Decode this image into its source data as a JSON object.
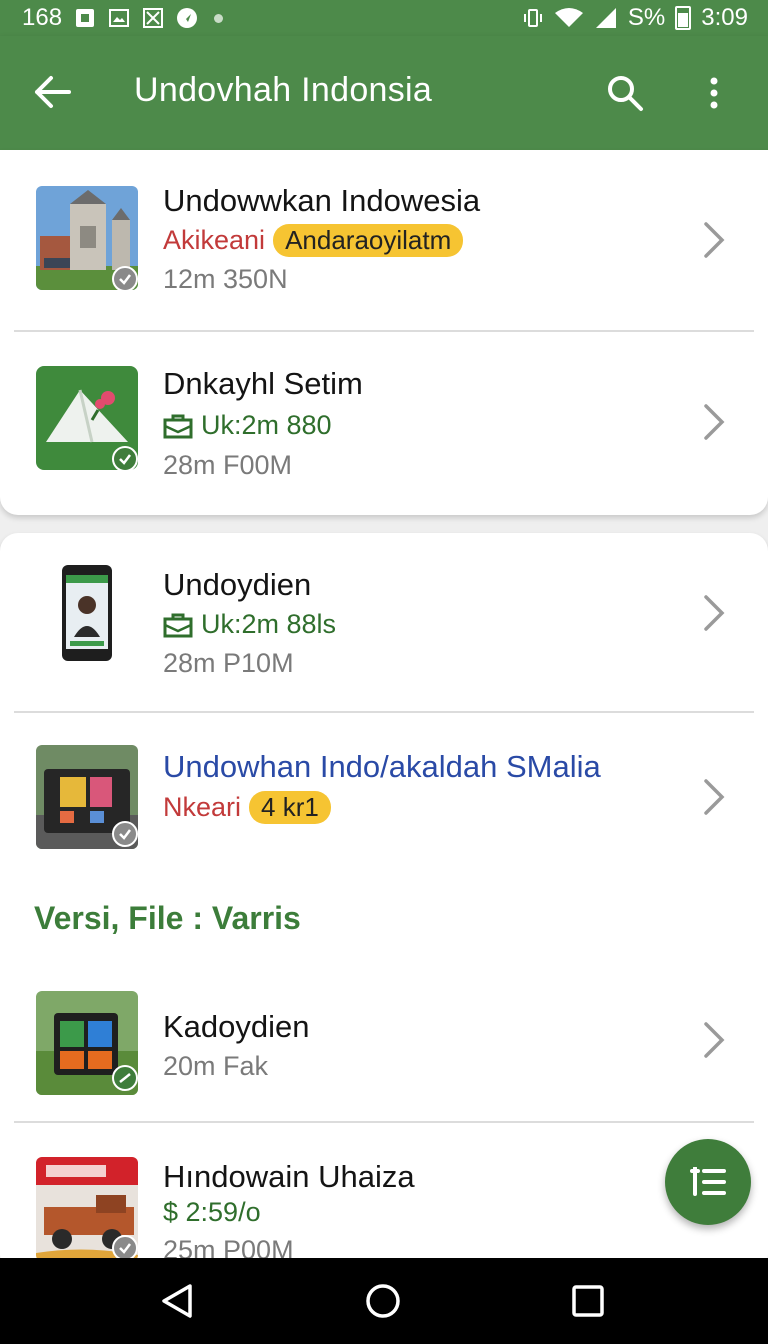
{
  "status_bar": {
    "left_text": "168",
    "battery_text": "S%",
    "time": "3:09",
    "icons": [
      "square-notification-icon",
      "image-notification-icon",
      "x-notification-icon",
      "navigation-notification-icon",
      "dot-icon",
      "vibrate-icon",
      "wifi-icon",
      "signal-icon",
      "battery-icon"
    ]
  },
  "app_bar": {
    "title": "Undovhah Indonsia",
    "icons": [
      "back-arrow-icon",
      "search-icon",
      "more-vert-icon"
    ]
  },
  "items": [
    {
      "title": "Undowwkan Indowesia",
      "subtitle_red": "Akikeani",
      "badge": "Andaraoyilatm",
      "meta": "12m 350N"
    },
    {
      "title": "Dnkayhl Setim",
      "subtitle_green": "Uk:2m 880",
      "meta": "28m F00M"
    },
    {
      "title": "Undoydien",
      "subtitle_green": "Uk:2m 88ls",
      "meta": "28m P10M"
    },
    {
      "title": "Undowhan Indo/akaldah SMalia",
      "subtitle_red": "Nkeari",
      "badge": "4 kr1"
    },
    {
      "title": "Kadoydien",
      "meta": "20m Fak"
    },
    {
      "title": "Hındowain Uhaiza",
      "price": "$ 2:59/o",
      "meta": "25m P00M"
    }
  ],
  "section": {
    "title": "Versi, File : Varris"
  },
  "colors": {
    "primary": "#4d8a4a",
    "accent_green": "#3f7d3b",
    "badge_yellow": "#f6c432",
    "red_text": "#c23a3a",
    "link_blue": "#2a4aa6"
  },
  "nav": {
    "icons": [
      "nav-back-icon",
      "nav-home-icon",
      "nav-recents-icon"
    ]
  }
}
